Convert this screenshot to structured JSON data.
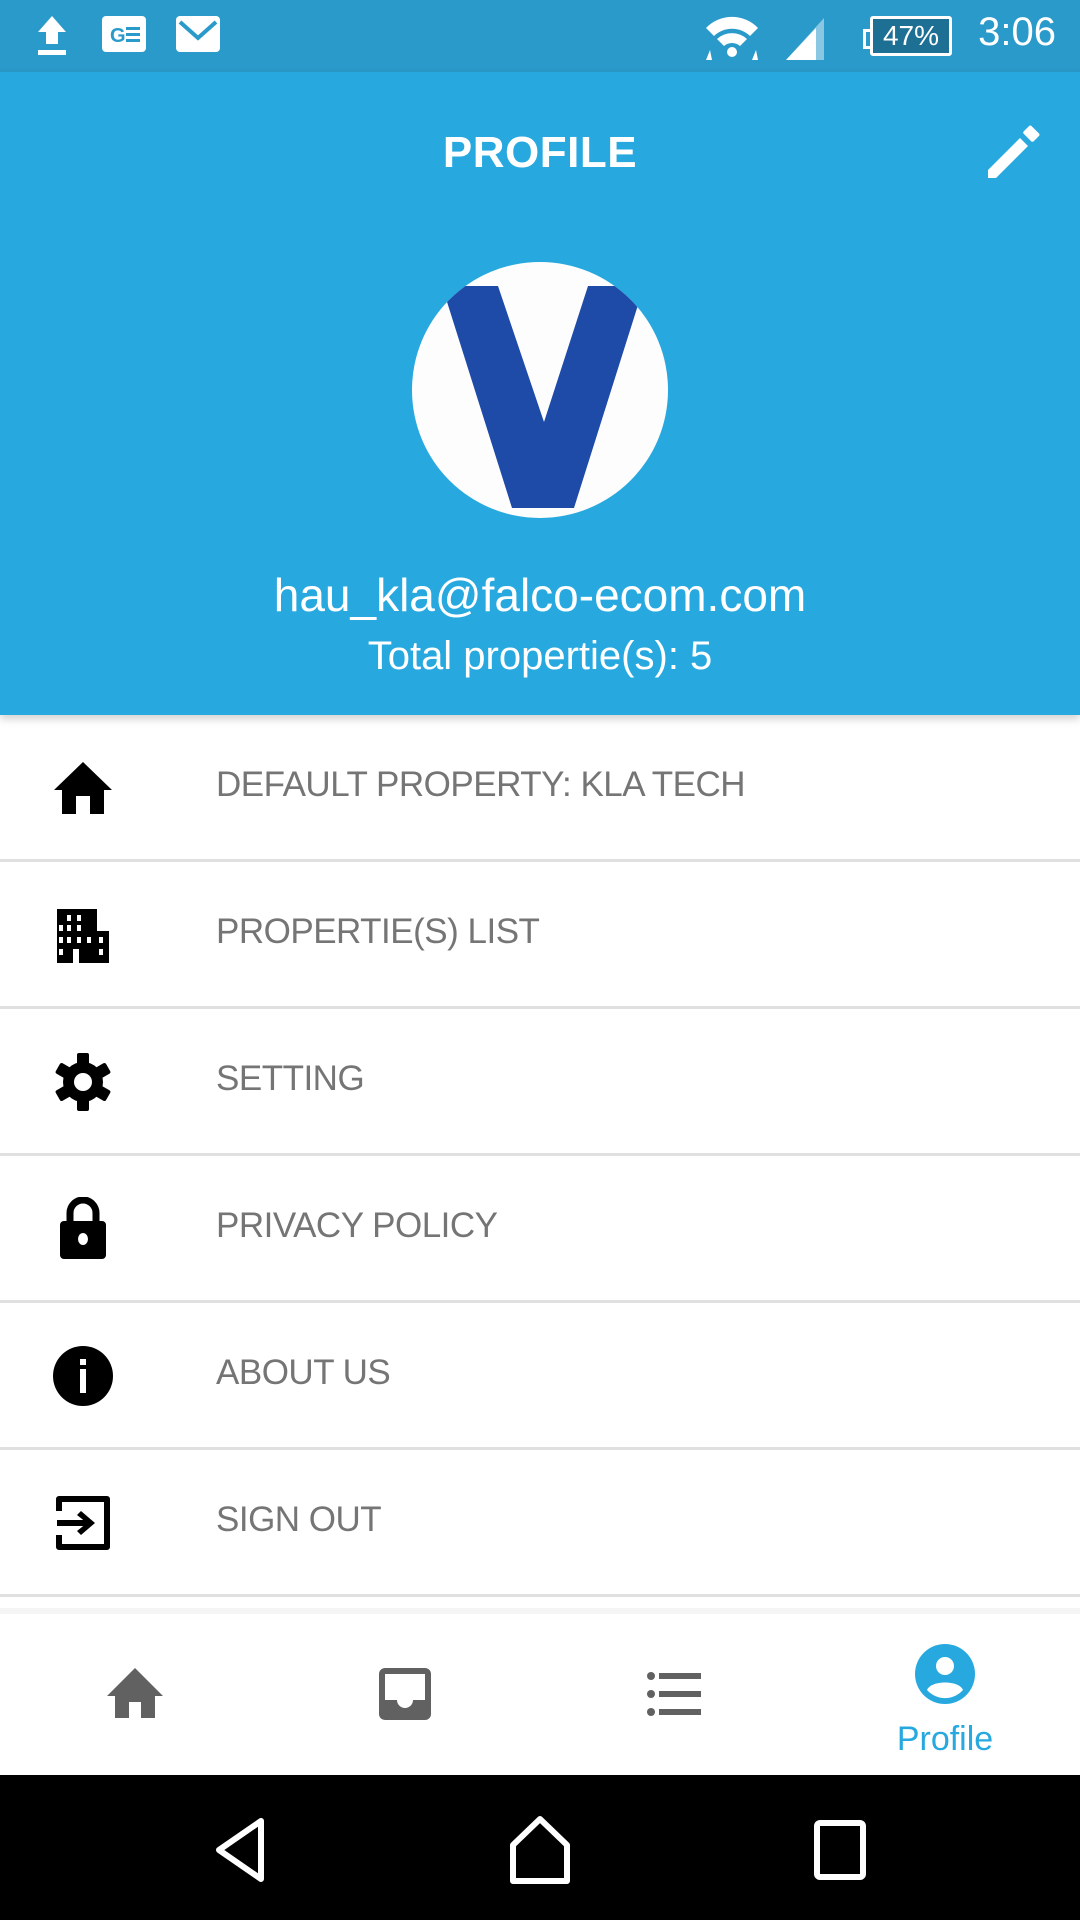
{
  "status_bar": {
    "notification_icons": [
      "upload-icon",
      "news-icon",
      "mail-icon"
    ],
    "system_icons": [
      "wifi-icon",
      "signal-icon"
    ],
    "battery": "47%",
    "time": "3:06"
  },
  "header": {
    "title": "PROFILE",
    "edit_icon": "pencil-icon",
    "avatar_letter": "V",
    "email": "hau_kla@falco-ecom.com",
    "total_properties": "Total propertie(s): 5"
  },
  "menu": {
    "items": [
      {
        "icon": "home-icon",
        "label": "DEFAULT PROPERTY: KLA TECH"
      },
      {
        "icon": "building-icon",
        "label": "PROPERTIE(S) LIST"
      },
      {
        "icon": "gear-icon",
        "label": "SETTING"
      },
      {
        "icon": "lock-icon",
        "label": "PRIVACY POLICY"
      },
      {
        "icon": "info-icon",
        "label": "ABOUT US"
      },
      {
        "icon": "sign-out-icon",
        "label": "SIGN OUT"
      }
    ]
  },
  "bottom_nav": {
    "tabs": [
      {
        "icon": "home-icon",
        "label": "",
        "active": false
      },
      {
        "icon": "inbox-icon",
        "label": "",
        "active": false
      },
      {
        "icon": "list-icon",
        "label": "",
        "active": false
      },
      {
        "icon": "profile-icon",
        "label": "Profile",
        "active": true
      }
    ]
  },
  "system_nav": {
    "buttons": [
      "back",
      "home",
      "recents"
    ]
  },
  "colors": {
    "status_bar": "#2a9aca",
    "primary": "#27a9e0",
    "menu_text": "#757575",
    "inactive_tab": "#616161",
    "avatar_logo": "#1e4aa8"
  }
}
